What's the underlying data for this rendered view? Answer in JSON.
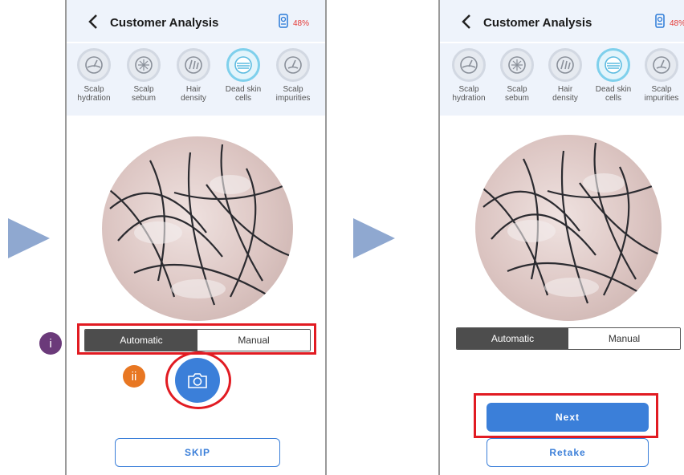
{
  "screens": [
    {
      "header": {
        "title": "Customer Analysis",
        "battery": "48%"
      },
      "metrics": [
        {
          "label": "Scalp\nhydration",
          "icon": "hydration-icon"
        },
        {
          "label": "Scalp\nsebum",
          "icon": "sebum-icon"
        },
        {
          "label": "Hair\ndensity",
          "icon": "hair-density-icon"
        },
        {
          "label": "Dead skin\ncells",
          "icon": "dead-skin-cells-icon",
          "active": true
        },
        {
          "label": "Scalp\nimpurities",
          "icon": "impurities-icon"
        }
      ],
      "mode": {
        "automatic": "Automatic",
        "manual": "Manual",
        "selected": "Automatic"
      },
      "skip_label": "SKIP",
      "annotations": {
        "mode_marker": "i",
        "capture_marker": "ii"
      }
    },
    {
      "header": {
        "title": "Customer Analysis",
        "battery": "48%"
      },
      "metrics": [
        {
          "label": "Scalp\nhydration",
          "icon": "hydration-icon"
        },
        {
          "label": "Scalp\nsebum",
          "icon": "sebum-icon"
        },
        {
          "label": "Hair\ndensity",
          "icon": "hair-density-icon"
        },
        {
          "label": "Dead skin\ncells",
          "icon": "dead-skin-cells-icon",
          "active": true
        },
        {
          "label": "Scalp\nimpurities",
          "icon": "impurities-icon"
        }
      ],
      "mode": {
        "automatic": "Automatic",
        "manual": "Manual",
        "selected": "Automatic"
      },
      "next_label": "Next",
      "retake_label": "Retake"
    }
  ],
  "colors": {
    "accent": "#3b7fd9",
    "highlight": "#e11b22",
    "battery": "#e53935",
    "header_bg": "#eef3fb"
  }
}
